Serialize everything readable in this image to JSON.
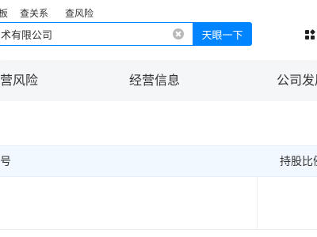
{
  "header": {
    "search_tabs": [
      "查老板",
      "查关系",
      "查风险"
    ],
    "search": {
      "value": "宁波某某科技有限公司",
      "visible_value": "术有限公司"
    },
    "search_button_label": "天眼一下"
  },
  "nav": {
    "tabs": [
      "经营风险",
      "经营信息",
      "公司发展"
    ]
  },
  "table": {
    "columns": [
      "序号",
      "持股比例"
    ]
  },
  "colors": {
    "accent": "#0084ff",
    "nav_bg": "#f5f6f8",
    "table_header_bg": "#f2f8ff",
    "text": "#333333"
  }
}
